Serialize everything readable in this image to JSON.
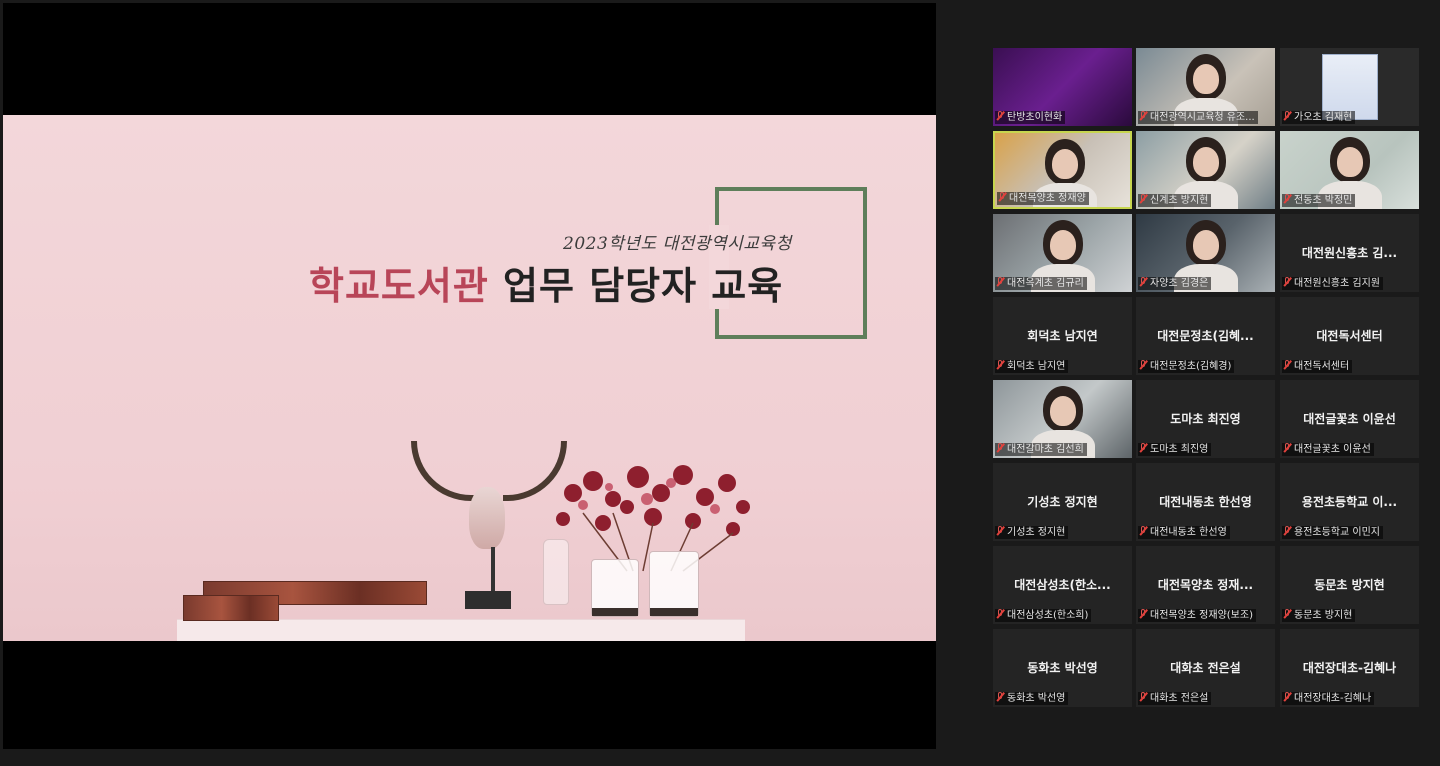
{
  "shared_screen": {
    "slide": {
      "subtitle": "2023학년도 대전광역시교육청",
      "title_accent": "학교도서관",
      "title_rest": " 업무 담당자 교육"
    }
  },
  "participants": [
    {
      "name": "탄방초이현화",
      "label": "탄방초이현화",
      "video": "purple"
    },
    {
      "name": "대전광역시교육청 유조...",
      "label": "대전광역시교육청 유조...",
      "video": "webcam"
    },
    {
      "name": "가오초 김재현",
      "label": "가오초 김재현",
      "video": "poster"
    },
    {
      "name": "대전목양초 정재양",
      "label": "대전목양초 정재양",
      "video": "webcam",
      "active": true
    },
    {
      "name": "신계초 방지현",
      "label": "신계초 방지현",
      "video": "webcam"
    },
    {
      "name": "전동초 박정민",
      "label": "전동초 박정민",
      "video": "webcam"
    },
    {
      "name": "대전옥계초 김규리",
      "label": "대전옥계초 김규리",
      "video": "webcam"
    },
    {
      "name": "자양초 김경은",
      "label": "자양초 김경은",
      "video": "webcam"
    },
    {
      "name": "대전원신흥초 김...",
      "label": "대전원신흥초 김지원",
      "video": "none"
    },
    {
      "name": "회덕초 남지연",
      "label": "회덕초 남지연",
      "video": "none"
    },
    {
      "name": "대전문정초(김혜...",
      "label": "대전문정초(김혜경)",
      "video": "none"
    },
    {
      "name": "대전독서센터",
      "label": "대전독서센터",
      "video": "none"
    },
    {
      "name": "대전갈마초 김선희",
      "label": "대전갈마초 김선희",
      "video": "webcam"
    },
    {
      "name": "도마초 최진영",
      "label": "도마초 최진영",
      "video": "none"
    },
    {
      "name": "대전글꽃초 이윤선",
      "label": "대전글꽃초 이윤선",
      "video": "none"
    },
    {
      "name": "기성초 정지현",
      "label": "기성초 정지현",
      "video": "none"
    },
    {
      "name": "대전내동초 한선영",
      "label": "대전내동초 한선영",
      "video": "none"
    },
    {
      "name": "용전초등학교 이...",
      "label": "용전초등학교 이민지",
      "video": "none"
    },
    {
      "name": "대전삼성초(한소...",
      "label": "대전삼성초(한소희)",
      "video": "none"
    },
    {
      "name": "대전목양초 정재...",
      "label": "대전목양초 정재양(보조)",
      "video": "none"
    },
    {
      "name": "동문초 방지현",
      "label": "동문초 방지현",
      "video": "none"
    },
    {
      "name": "동화초 박선영",
      "label": "동화초 박선영",
      "video": "none"
    },
    {
      "name": "대화초 전은설",
      "label": "대화초 전은설",
      "video": "none"
    },
    {
      "name": "대전장대초-김혜나",
      "label": "대전장대초-김혜나",
      "video": "none"
    }
  ],
  "colors": {
    "slide_accent": "#b84558",
    "frame_green": "#5e7e5a",
    "active_speaker_border": "#c7d64f",
    "muted_mic": "#d9534f"
  }
}
